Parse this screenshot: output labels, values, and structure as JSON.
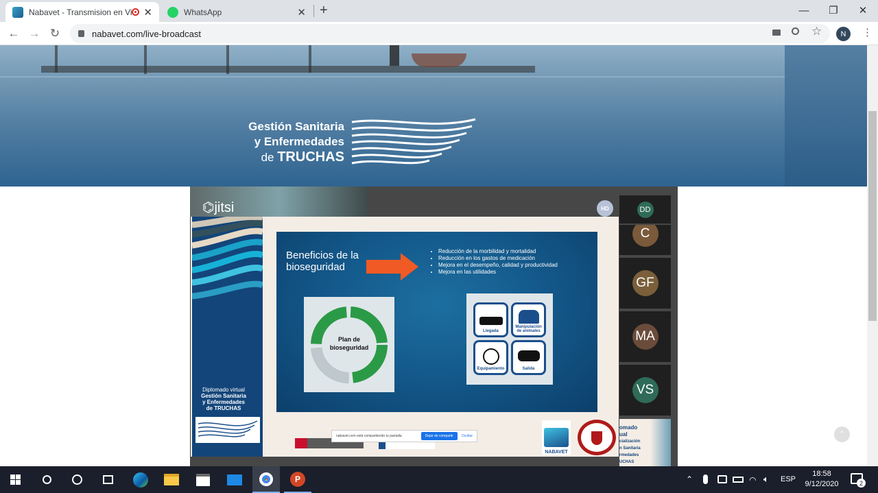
{
  "tabs": [
    {
      "title": "Nabavet - Transmision en Vi",
      "active": true
    },
    {
      "title": "WhatsApp",
      "active": false
    }
  ],
  "window_controls": {
    "minimize": "—",
    "restore": "❐",
    "close": "✕"
  },
  "address": {
    "url": "nabavet.com/live-broadcast",
    "profile_initial": "N"
  },
  "banner": {
    "line1": "Gestión Sanitaria",
    "line2": "y Enfermedades",
    "line3_prefix": "de",
    "line3_main": "TRUCHAS"
  },
  "jitsi": {
    "logo": "jitsi",
    "quality_badge": "HD"
  },
  "slide": {
    "title_line1": "Beneficios de la",
    "title_line2": "bioseguridad",
    "bullets": [
      "Reducción de la morbilidad y mortalidad",
      "Reducción en los gastos de medicación",
      "Mejora en el desempeño, calidad y productividad",
      "Mejora en las utilidades"
    ],
    "cycle_center_line1": "Plan de",
    "cycle_center_line2": "bioseguridad",
    "icons": [
      "Llegada",
      "Manipulación de animales",
      "Equipamiento",
      "Salida"
    ],
    "side_title": [
      "Diplomado virtual",
      "Gestión Sanitaria",
      "y Enfermedades",
      "de TRUCHAS"
    ],
    "share_bar": {
      "text": "nabavet.com está compartiendo tu pantalla",
      "stop": "Dejar de compartir",
      "hide": "Ocultar"
    },
    "logo_nabavet": "NABAVET"
  },
  "participants": [
    {
      "initials": "DD",
      "color": "#2e6b57"
    },
    {
      "initials": "C",
      "color": "#7a5a3a"
    },
    {
      "initials": "GF",
      "color": "#7a5f3a"
    },
    {
      "initials": "MA",
      "color": "#6b4c3a"
    },
    {
      "initials": "VS",
      "color": "#2f6b58"
    }
  ],
  "thumb_preview": [
    "omado",
    "ual",
    "cialización",
    "n Sanitaria",
    "rmedades",
    "UCHAS"
  ],
  "taskbar": {
    "lang": "ESP",
    "time": "18:58",
    "date": "9/12/2020",
    "notifications": "2"
  }
}
